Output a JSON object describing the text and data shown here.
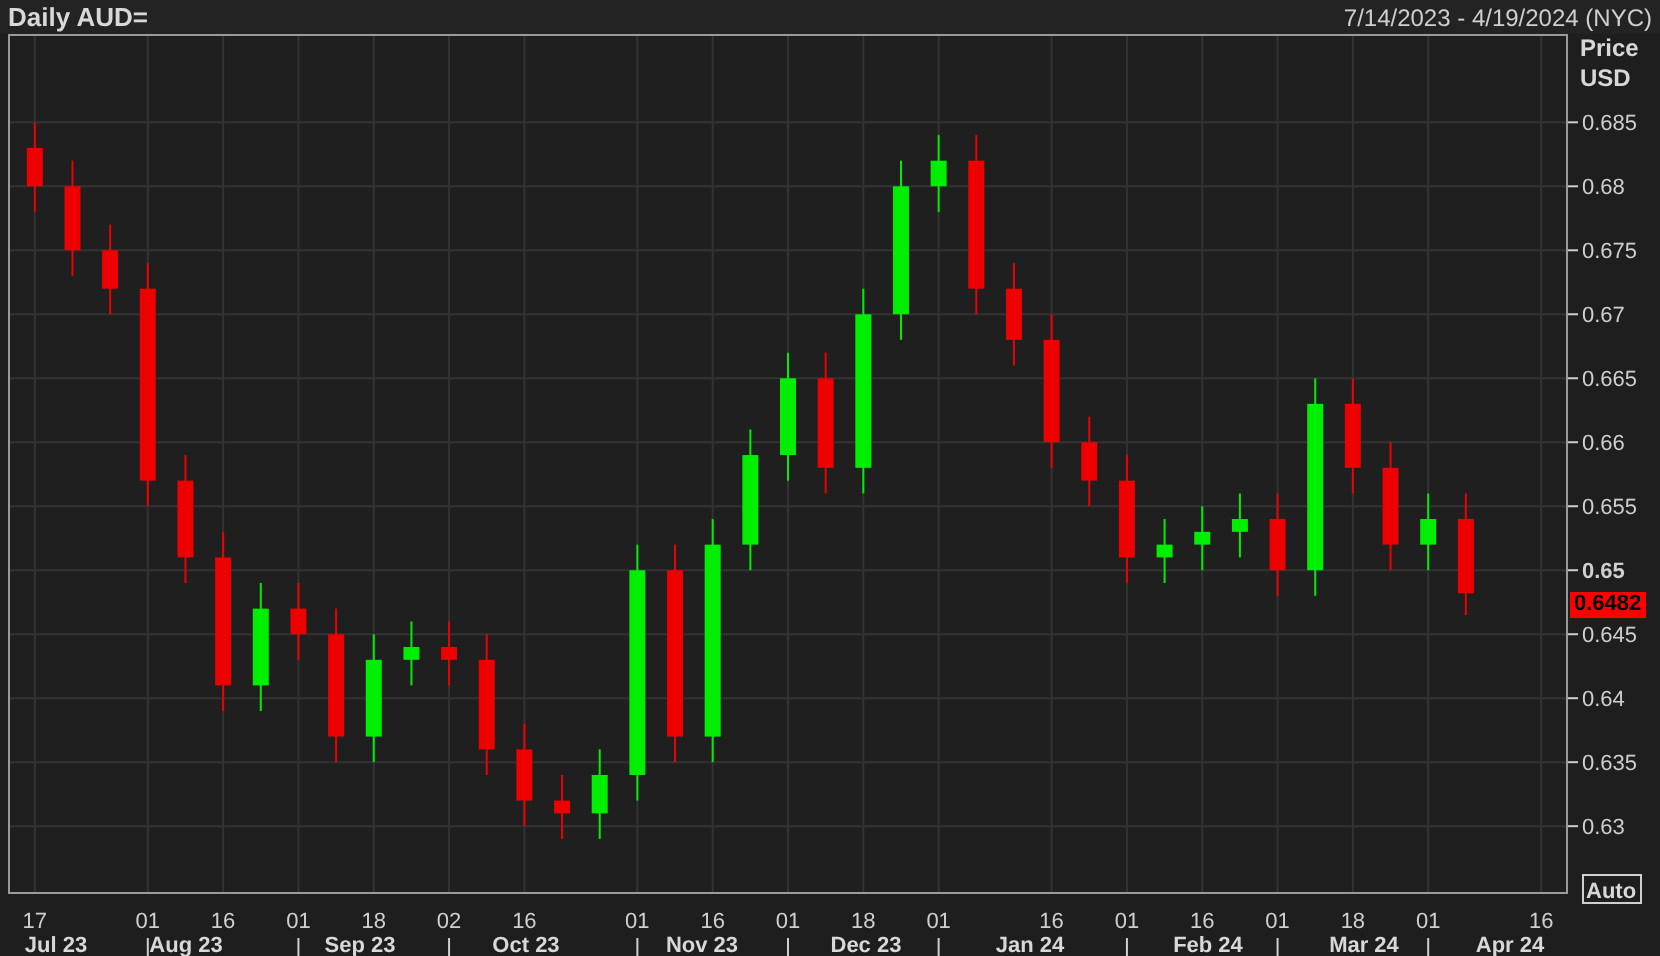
{
  "header": {
    "title": "Daily AUD=",
    "date_range": "7/14/2023 - 4/19/2024 (NYC)"
  },
  "price_axis": {
    "title_line_1": "Price",
    "title_line_2": "USD",
    "last_price": "0.6482",
    "auto_button": "Auto"
  },
  "time_axis": {
    "month_labels": [
      "Jul 23",
      "Aug 23",
      "Sep 23",
      "Oct 23",
      "Nov 23",
      "Dec 23",
      "Jan 24",
      "Feb 24",
      "Mar 24",
      "Apr 24"
    ]
  },
  "chart_data": {
    "type": "candlestick",
    "grid": true,
    "categories": [
      "17",
      null,
      null,
      "01",
      null,
      "16",
      null,
      "01",
      null,
      "18",
      null,
      "02",
      null,
      "16",
      null,
      null,
      "01",
      null,
      "16",
      null,
      "01",
      null,
      "18",
      null,
      "01",
      null,
      null,
      "16",
      null,
      "01",
      null,
      "16",
      null,
      "01",
      null,
      "18",
      null,
      "01",
      null,
      null,
      "16"
    ],
    "ohlc": [
      [
        0.683,
        0.685,
        0.678,
        0.68
      ],
      [
        0.68,
        0.682,
        0.673,
        0.675
      ],
      [
        0.675,
        0.677,
        0.67,
        0.672
      ],
      [
        0.672,
        0.674,
        0.655,
        0.657
      ],
      [
        0.657,
        0.659,
        0.649,
        0.651
      ],
      [
        0.651,
        0.653,
        0.639,
        0.641
      ],
      [
        0.641,
        0.649,
        0.639,
        0.647
      ],
      [
        0.647,
        0.649,
        0.643,
        0.645
      ],
      [
        0.645,
        0.647,
        0.635,
        0.637
      ],
      [
        0.637,
        0.645,
        0.635,
        0.643
      ],
      [
        0.643,
        0.646,
        0.641,
        0.644
      ],
      [
        0.644,
        0.646,
        0.641,
        0.643
      ],
      [
        0.643,
        0.645,
        0.634,
        0.636
      ],
      [
        0.636,
        0.638,
        0.63,
        0.632
      ],
      [
        0.632,
        0.634,
        0.629,
        0.631
      ],
      [
        0.631,
        0.636,
        0.629,
        0.634
      ],
      [
        0.634,
        0.652,
        0.632,
        0.65
      ],
      [
        0.65,
        0.652,
        0.635,
        0.637
      ],
      [
        0.637,
        0.654,
        0.635,
        0.652
      ],
      [
        0.652,
        0.661,
        0.65,
        0.659
      ],
      [
        0.659,
        0.667,
        0.657,
        0.665
      ],
      [
        0.665,
        0.667,
        0.656,
        0.658
      ],
      [
        0.658,
        0.672,
        0.656,
        0.67
      ],
      [
        0.67,
        0.682,
        0.668,
        0.68
      ],
      [
        0.68,
        0.684,
        0.678,
        0.682
      ],
      [
        0.682,
        0.684,
        0.67,
        0.672
      ],
      [
        0.672,
        0.674,
        0.666,
        0.668
      ],
      [
        0.668,
        0.67,
        0.658,
        0.66
      ],
      [
        0.66,
        0.662,
        0.655,
        0.657
      ],
      [
        0.657,
        0.659,
        0.649,
        0.651
      ],
      [
        0.651,
        0.654,
        0.649,
        0.652
      ],
      [
        0.652,
        0.655,
        0.65,
        0.653
      ],
      [
        0.653,
        0.656,
        0.651,
        0.654
      ],
      [
        0.654,
        0.656,
        0.648,
        0.65
      ],
      [
        0.65,
        0.665,
        0.648,
        0.663
      ],
      [
        0.663,
        0.665,
        0.656,
        0.658
      ],
      [
        0.658,
        0.66,
        0.65,
        0.652
      ],
      [
        0.652,
        0.656,
        0.65,
        0.654
      ],
      [
        0.654,
        0.656,
        0.6465,
        0.6482
      ],
      null,
      null
    ],
    "ylim": [
      0.6247,
      0.6919
    ],
    "yticks": [
      0.63,
      0.635,
      0.64,
      0.645,
      0.65,
      0.655,
      0.66,
      0.665,
      0.67,
      0.675,
      0.68,
      0.685
    ]
  }
}
